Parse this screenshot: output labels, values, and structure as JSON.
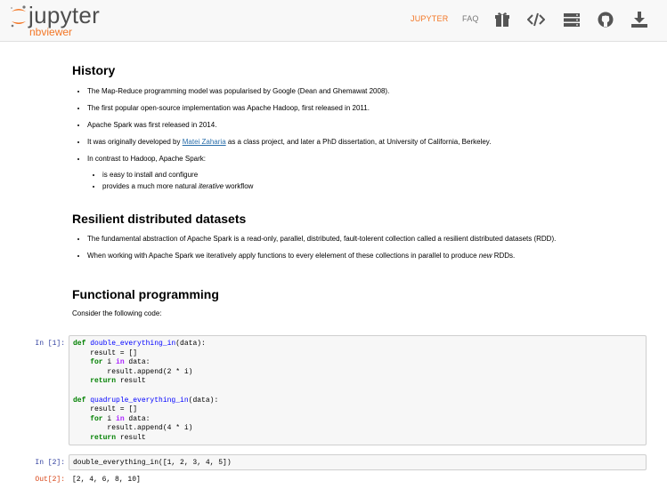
{
  "navbar": {
    "brand_word": "jupyter",
    "brand_sub": "nbviewer",
    "links": [
      {
        "label": "JUPYTER",
        "active": true
      },
      {
        "label": "FAQ",
        "active": false
      }
    ],
    "icons": [
      "gift-icon",
      "code-icon",
      "server-icon",
      "github-icon",
      "download-icon"
    ],
    "accent_color": "#f37726"
  },
  "history": {
    "heading": "History",
    "items": [
      "The Map-Reduce programming model was popularised by Google (Dean and Ghemawat 2008).",
      "The first popular open-source implementation was Apache Hadoop, first released in 2011.",
      "Apache Spark was first released in 2014."
    ],
    "dev_item": {
      "before": "It was originally developed by ",
      "link": "Matei Zaharia",
      "after": " as a class project, and later a PhD dissertation, at University of California, Berkeley."
    },
    "contrast_item": "In contrast to Hadoop, Apache Spark:",
    "sub_items": [
      {
        "before": "is easy to install and configure",
        "em": "",
        "after": ""
      },
      {
        "before": "provides a much more natural ",
        "em": "iterative",
        "after": " workflow"
      }
    ]
  },
  "rdd": {
    "heading": "Resilient distributed datasets",
    "item1": "The fundamental abstraction of Apache Spark is a read-only, parallel, distributed, fault-tolerent collection called a resilient distributed datasets (RDD).",
    "item2": {
      "before": "When working with Apache Spark we iteratively apply functions to every elelement of these collections in parallel to produce ",
      "em": "new",
      "after": " RDDs."
    }
  },
  "functional": {
    "heading": "Functional programming",
    "intro": "Consider the following code:"
  },
  "cells": [
    {
      "prompt": "In [1]:",
      "lines": [
        "def double_everything_in(data):",
        "    result = []",
        "    for i in data:",
        "        result.append(2 * i)",
        "    return result",
        "",
        "def quadruple_everything_in(data):",
        "    result = []",
        "    for i in data:",
        "        result.append(4 * i)",
        "    return result"
      ]
    },
    {
      "prompt": "In [2]:",
      "lines": [
        "double_everything_in([1, 2, 3, 4, 5])"
      ],
      "out_prompt": "Out[2]:",
      "output": "[2, 4, 6, 8, 10]"
    }
  ]
}
